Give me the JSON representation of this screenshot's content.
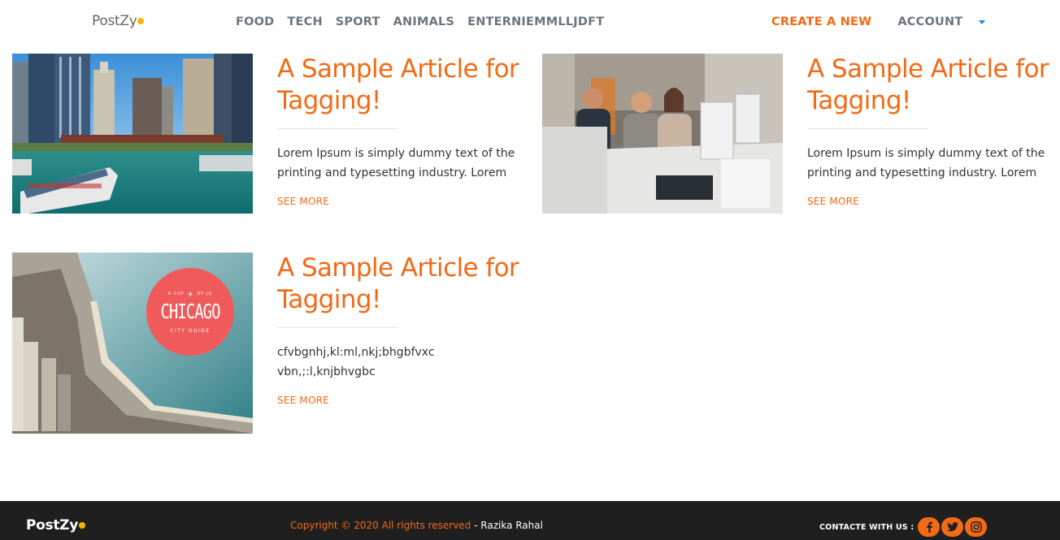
{
  "nav": {
    "brand": "PostZy",
    "links": [
      "FOOD",
      "TECH",
      "SPORT",
      "ANIMALS",
      "ENTERNIEMMLLJDFT"
    ],
    "create": "CREATE A NEW",
    "account": "ACCOUNT"
  },
  "articles": [
    {
      "title": "A Sample Article for Tagging!",
      "excerpt": "Lorem Ipsum is simply dummy text of the printing and typesetting industry. Lorem",
      "see_more": "SEE MORE"
    },
    {
      "title": "A Sample Article for Tagging!",
      "excerpt": "Lorem Ipsum is simply dummy text of the printing and typesetting industry. Lorem",
      "see_more": "SEE MORE"
    },
    {
      "title": "A Sample Article for Tagging!",
      "excerpt": "cfvbgnhj,kl:ml,nkj;bhgbfvxc vbn,;:l,knjbhvgbc",
      "see_more": "SEE MORE",
      "image_text": {
        "tagline_left": "A CUP",
        "tagline_right": "OF JO",
        "city": "CHICAGO",
        "subtitle": "CITY GUIDE"
      }
    }
  ],
  "footer": {
    "brand": "PostZy",
    "copyright": "Copyright © 2020 All rights reserved",
    "separator": " - ",
    "author": "Razika Rahal",
    "contact_label": "CONTACTE WITH US :",
    "social_icons": [
      "facebook-icon",
      "twitter-icon",
      "instagram-icon"
    ]
  },
  "colors": {
    "accent": "#f26a15",
    "nav_text": "#6c757d",
    "footer_bg": "#1f1f1f",
    "brand_dot": "#f5b700"
  }
}
